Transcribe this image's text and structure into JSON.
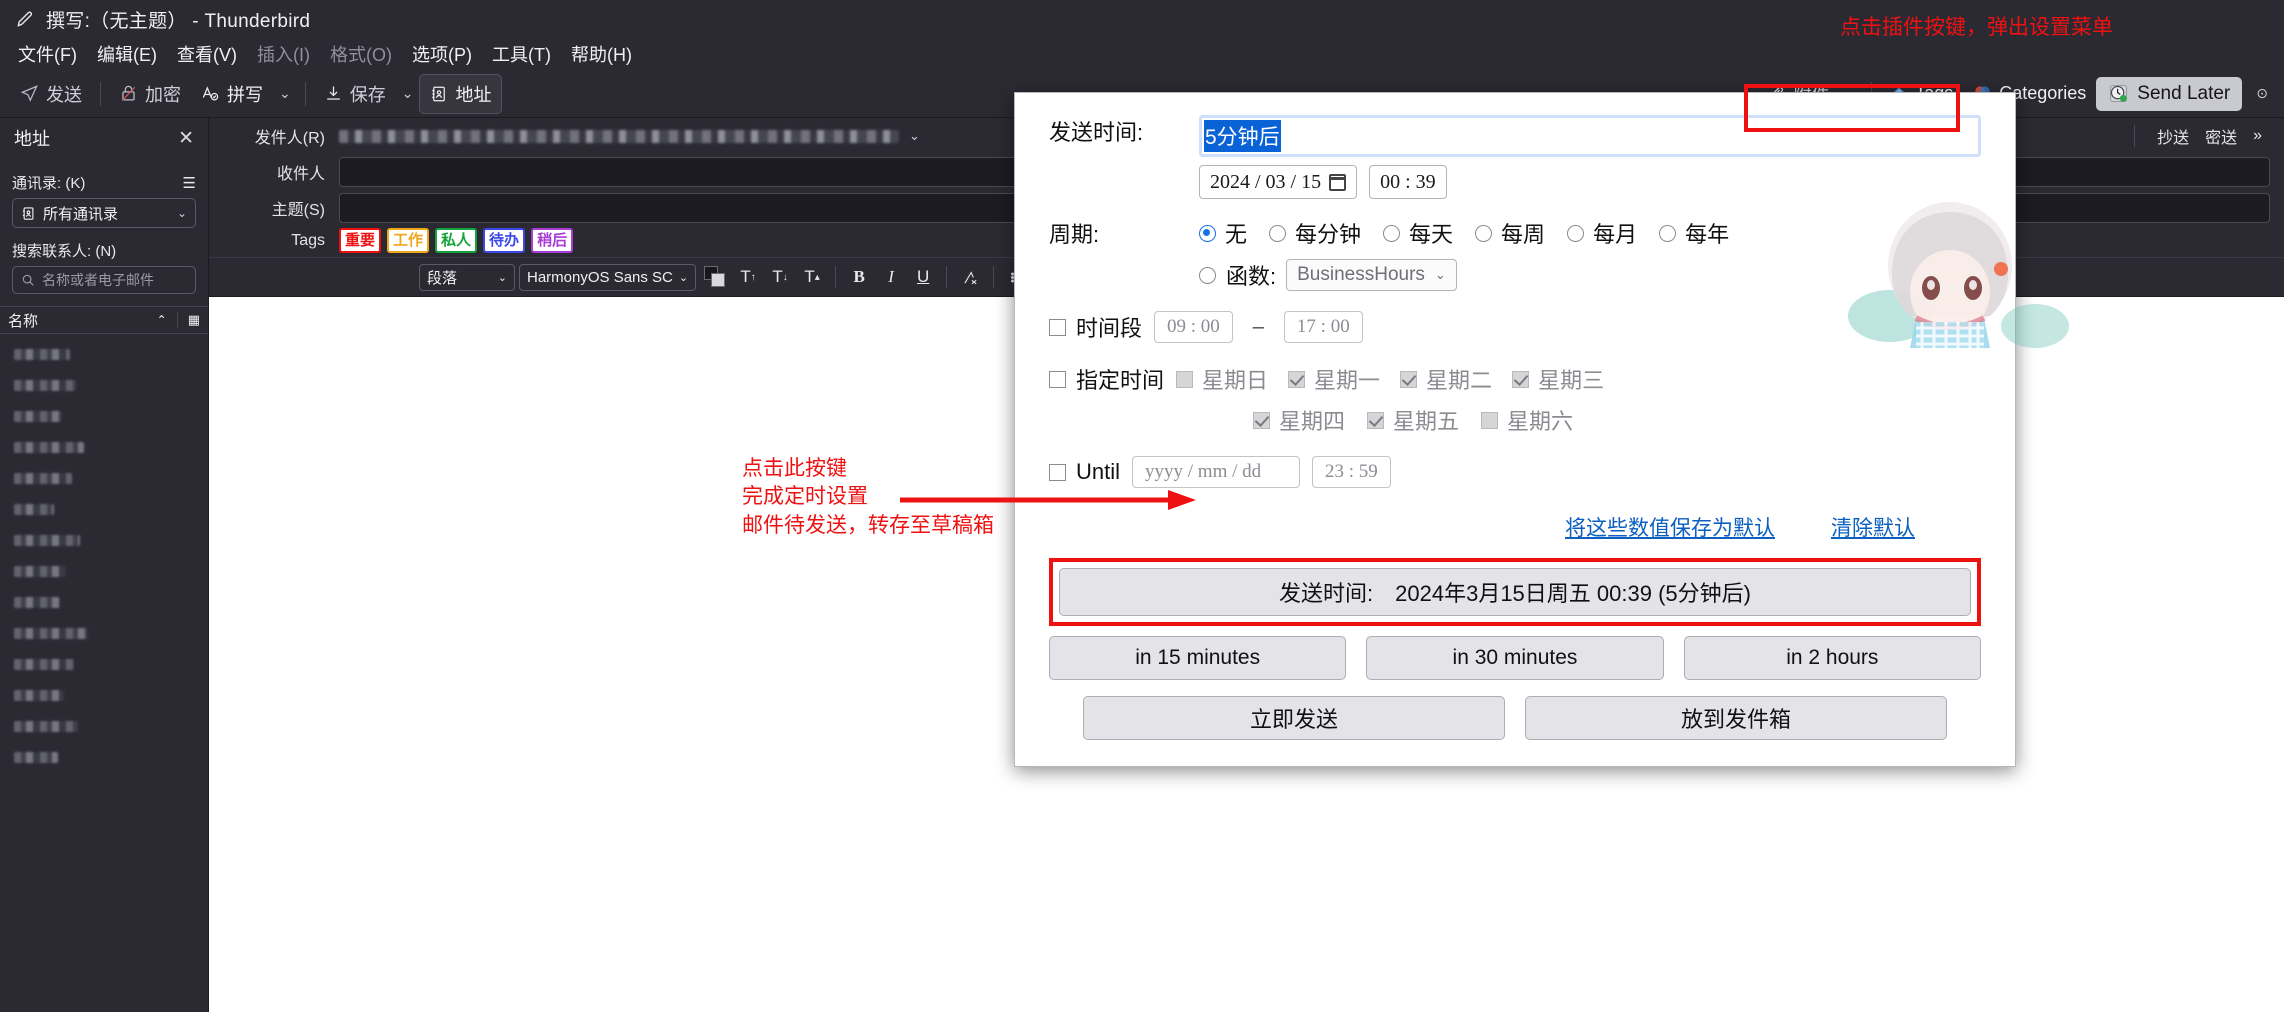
{
  "window": {
    "title": "撰写:（无主题） - Thunderbird",
    "icon": "pencil-icon"
  },
  "menubar": [
    {
      "label": "文件(F)",
      "disabled": false
    },
    {
      "label": "编辑(E)",
      "disabled": false
    },
    {
      "label": "查看(V)",
      "disabled": false
    },
    {
      "label": "插入(I)",
      "disabled": true
    },
    {
      "label": "格式(O)",
      "disabled": true
    },
    {
      "label": "选项(P)",
      "disabled": false
    },
    {
      "label": "工具(T)",
      "disabled": false
    },
    {
      "label": "帮助(H)",
      "disabled": false
    }
  ],
  "toolbar": {
    "send": "发送",
    "encrypt": "加密",
    "spelling": "拼写",
    "save": "保存",
    "address": "地址",
    "attach": "附件",
    "tags": "Tags",
    "categories": "Categories",
    "send_later": "Send Later"
  },
  "sidebar": {
    "title": "地址",
    "close": "✕",
    "addressbook_label": "通讯录: (K)",
    "addressbook_value": "所有通讯录",
    "search_label": "搜索联系人: (N)",
    "search_placeholder": "名称或者电子邮件",
    "column_name": "名称",
    "contact_count": 14
  },
  "compose": {
    "from_label": "发件人(R)",
    "to_label": "收件人",
    "subject_label": "主题(S)",
    "cc_label": "抄送",
    "bcc_label": "密送",
    "more_label": "»",
    "to_value": "",
    "subject_value": "",
    "tags_label": "Tags",
    "tags": [
      {
        "label": "重要",
        "color": "#ee1111"
      },
      {
        "label": "工作",
        "color": "#efa71c"
      },
      {
        "label": "私人",
        "color": "#15a33c"
      },
      {
        "label": "待办",
        "color": "#3b48e8"
      },
      {
        "label": "稍后",
        "color": "#a93bd6"
      }
    ],
    "format": {
      "paragraph": "段落",
      "font": "HarmonyOS Sans SC",
      "buttons": [
        "increase-font-icon",
        "decrease-font-icon",
        "font-size-icon",
        "bold-icon",
        "italic-icon",
        "underline-icon",
        "remove-formatting-icon",
        "bullet-list-icon",
        "numbered-list-icon",
        "outdent-icon",
        "indent-icon",
        "align-icon",
        "image-icon",
        "emoji-icon"
      ]
    }
  },
  "popup": {
    "sendtime_label": "发送时间:",
    "sendtime_value": "5分钟后",
    "date_value": "2024 / 03 / 15",
    "time_value": "00 : 39",
    "recurrence_label": "周期:",
    "recurrence_options": [
      {
        "label": "无",
        "selected": true
      },
      {
        "label": "每分钟",
        "selected": false
      },
      {
        "label": "每天",
        "selected": false
      },
      {
        "label": "每周",
        "selected": false
      },
      {
        "label": "每月",
        "selected": false
      },
      {
        "label": "每年",
        "selected": false
      }
    ],
    "function_label": "函数:",
    "function_value": "BusinessHours",
    "timerange_label": "时间段",
    "timerange_from": "09 : 00",
    "timerange_to": "17 : 00",
    "timerange_checked": false,
    "weekday_label": "指定时间",
    "weekday_checked": false,
    "weekdays": [
      {
        "label": "星期日",
        "checked": false
      },
      {
        "label": "星期一",
        "checked": true
      },
      {
        "label": "星期二",
        "checked": true
      },
      {
        "label": "星期三",
        "checked": true
      },
      {
        "label": "星期四",
        "checked": true
      },
      {
        "label": "星期五",
        "checked": true
      },
      {
        "label": "星期六",
        "checked": false
      }
    ],
    "until_label": "Until",
    "until_checked": false,
    "until_date_placeholder": "yyyy / mm / dd",
    "until_time": "23 : 59",
    "save_defaults_link": "将这些数值保存为默认",
    "clear_defaults_link": "清除默认",
    "primary_button": "发送时间:　2024年3月15日周五 00:39 (5分钟后)",
    "quick_buttons": [
      "in 15 minutes",
      "in 30 minutes",
      "in 2 hours"
    ],
    "footer_buttons": [
      "立即发送",
      "放到发件箱"
    ]
  },
  "annotations": {
    "top": "点击插件按键，弹出设置菜单",
    "left": "点击此按键\n完成定时设置\n邮件待发送，转存至草稿箱",
    "accent": "#ee1111"
  }
}
